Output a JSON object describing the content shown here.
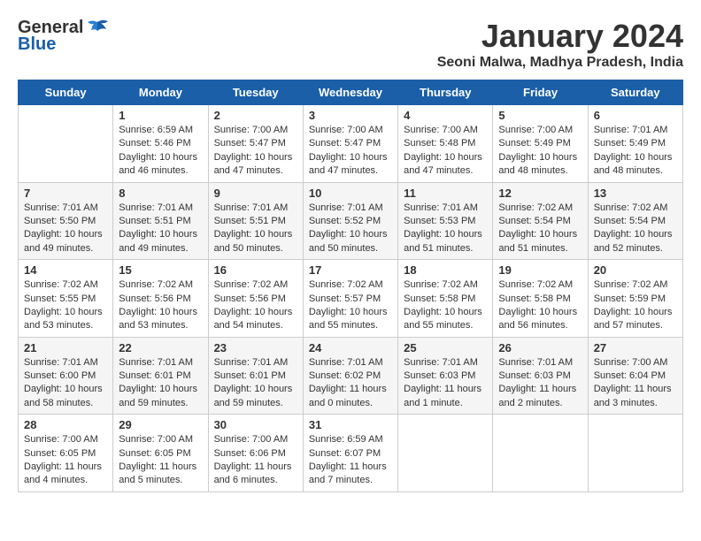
{
  "header": {
    "logo_general": "General",
    "logo_blue": "Blue",
    "title": "January 2024",
    "subtitle": "Seoni Malwa, Madhya Pradesh, India"
  },
  "days": [
    "Sunday",
    "Monday",
    "Tuesday",
    "Wednesday",
    "Thursday",
    "Friday",
    "Saturday"
  ],
  "weeks": [
    [
      {
        "date": "",
        "sunrise": "",
        "sunset": "",
        "daylight": ""
      },
      {
        "date": "1",
        "sunrise": "Sunrise: 6:59 AM",
        "sunset": "Sunset: 5:46 PM",
        "daylight": "Daylight: 10 hours and 46 minutes."
      },
      {
        "date": "2",
        "sunrise": "Sunrise: 7:00 AM",
        "sunset": "Sunset: 5:47 PM",
        "daylight": "Daylight: 10 hours and 47 minutes."
      },
      {
        "date": "3",
        "sunrise": "Sunrise: 7:00 AM",
        "sunset": "Sunset: 5:47 PM",
        "daylight": "Daylight: 10 hours and 47 minutes."
      },
      {
        "date": "4",
        "sunrise": "Sunrise: 7:00 AM",
        "sunset": "Sunset: 5:48 PM",
        "daylight": "Daylight: 10 hours and 47 minutes."
      },
      {
        "date": "5",
        "sunrise": "Sunrise: 7:00 AM",
        "sunset": "Sunset: 5:49 PM",
        "daylight": "Daylight: 10 hours and 48 minutes."
      },
      {
        "date": "6",
        "sunrise": "Sunrise: 7:01 AM",
        "sunset": "Sunset: 5:49 PM",
        "daylight": "Daylight: 10 hours and 48 minutes."
      }
    ],
    [
      {
        "date": "7",
        "sunrise": "Sunrise: 7:01 AM",
        "sunset": "Sunset: 5:50 PM",
        "daylight": "Daylight: 10 hours and 49 minutes."
      },
      {
        "date": "8",
        "sunrise": "Sunrise: 7:01 AM",
        "sunset": "Sunset: 5:51 PM",
        "daylight": "Daylight: 10 hours and 49 minutes."
      },
      {
        "date": "9",
        "sunrise": "Sunrise: 7:01 AM",
        "sunset": "Sunset: 5:51 PM",
        "daylight": "Daylight: 10 hours and 50 minutes."
      },
      {
        "date": "10",
        "sunrise": "Sunrise: 7:01 AM",
        "sunset": "Sunset: 5:52 PM",
        "daylight": "Daylight: 10 hours and 50 minutes."
      },
      {
        "date": "11",
        "sunrise": "Sunrise: 7:01 AM",
        "sunset": "Sunset: 5:53 PM",
        "daylight": "Daylight: 10 hours and 51 minutes."
      },
      {
        "date": "12",
        "sunrise": "Sunrise: 7:02 AM",
        "sunset": "Sunset: 5:54 PM",
        "daylight": "Daylight: 10 hours and 51 minutes."
      },
      {
        "date": "13",
        "sunrise": "Sunrise: 7:02 AM",
        "sunset": "Sunset: 5:54 PM",
        "daylight": "Daylight: 10 hours and 52 minutes."
      }
    ],
    [
      {
        "date": "14",
        "sunrise": "Sunrise: 7:02 AM",
        "sunset": "Sunset: 5:55 PM",
        "daylight": "Daylight: 10 hours and 53 minutes."
      },
      {
        "date": "15",
        "sunrise": "Sunrise: 7:02 AM",
        "sunset": "Sunset: 5:56 PM",
        "daylight": "Daylight: 10 hours and 53 minutes."
      },
      {
        "date": "16",
        "sunrise": "Sunrise: 7:02 AM",
        "sunset": "Sunset: 5:56 PM",
        "daylight": "Daylight: 10 hours and 54 minutes."
      },
      {
        "date": "17",
        "sunrise": "Sunrise: 7:02 AM",
        "sunset": "Sunset: 5:57 PM",
        "daylight": "Daylight: 10 hours and 55 minutes."
      },
      {
        "date": "18",
        "sunrise": "Sunrise: 7:02 AM",
        "sunset": "Sunset: 5:58 PM",
        "daylight": "Daylight: 10 hours and 55 minutes."
      },
      {
        "date": "19",
        "sunrise": "Sunrise: 7:02 AM",
        "sunset": "Sunset: 5:58 PM",
        "daylight": "Daylight: 10 hours and 56 minutes."
      },
      {
        "date": "20",
        "sunrise": "Sunrise: 7:02 AM",
        "sunset": "Sunset: 5:59 PM",
        "daylight": "Daylight: 10 hours and 57 minutes."
      }
    ],
    [
      {
        "date": "21",
        "sunrise": "Sunrise: 7:01 AM",
        "sunset": "Sunset: 6:00 PM",
        "daylight": "Daylight: 10 hours and 58 minutes."
      },
      {
        "date": "22",
        "sunrise": "Sunrise: 7:01 AM",
        "sunset": "Sunset: 6:01 PM",
        "daylight": "Daylight: 10 hours and 59 minutes."
      },
      {
        "date": "23",
        "sunrise": "Sunrise: 7:01 AM",
        "sunset": "Sunset: 6:01 PM",
        "daylight": "Daylight: 10 hours and 59 minutes."
      },
      {
        "date": "24",
        "sunrise": "Sunrise: 7:01 AM",
        "sunset": "Sunset: 6:02 PM",
        "daylight": "Daylight: 11 hours and 0 minutes."
      },
      {
        "date": "25",
        "sunrise": "Sunrise: 7:01 AM",
        "sunset": "Sunset: 6:03 PM",
        "daylight": "Daylight: 11 hours and 1 minute."
      },
      {
        "date": "26",
        "sunrise": "Sunrise: 7:01 AM",
        "sunset": "Sunset: 6:03 PM",
        "daylight": "Daylight: 11 hours and 2 minutes."
      },
      {
        "date": "27",
        "sunrise": "Sunrise: 7:00 AM",
        "sunset": "Sunset: 6:04 PM",
        "daylight": "Daylight: 11 hours and 3 minutes."
      }
    ],
    [
      {
        "date": "28",
        "sunrise": "Sunrise: 7:00 AM",
        "sunset": "Sunset: 6:05 PM",
        "daylight": "Daylight: 11 hours and 4 minutes."
      },
      {
        "date": "29",
        "sunrise": "Sunrise: 7:00 AM",
        "sunset": "Sunset: 6:05 PM",
        "daylight": "Daylight: 11 hours and 5 minutes."
      },
      {
        "date": "30",
        "sunrise": "Sunrise: 7:00 AM",
        "sunset": "Sunset: 6:06 PM",
        "daylight": "Daylight: 11 hours and 6 minutes."
      },
      {
        "date": "31",
        "sunrise": "Sunrise: 6:59 AM",
        "sunset": "Sunset: 6:07 PM",
        "daylight": "Daylight: 11 hours and 7 minutes."
      },
      {
        "date": "",
        "sunrise": "",
        "sunset": "",
        "daylight": ""
      },
      {
        "date": "",
        "sunrise": "",
        "sunset": "",
        "daylight": ""
      },
      {
        "date": "",
        "sunrise": "",
        "sunset": "",
        "daylight": ""
      }
    ]
  ]
}
